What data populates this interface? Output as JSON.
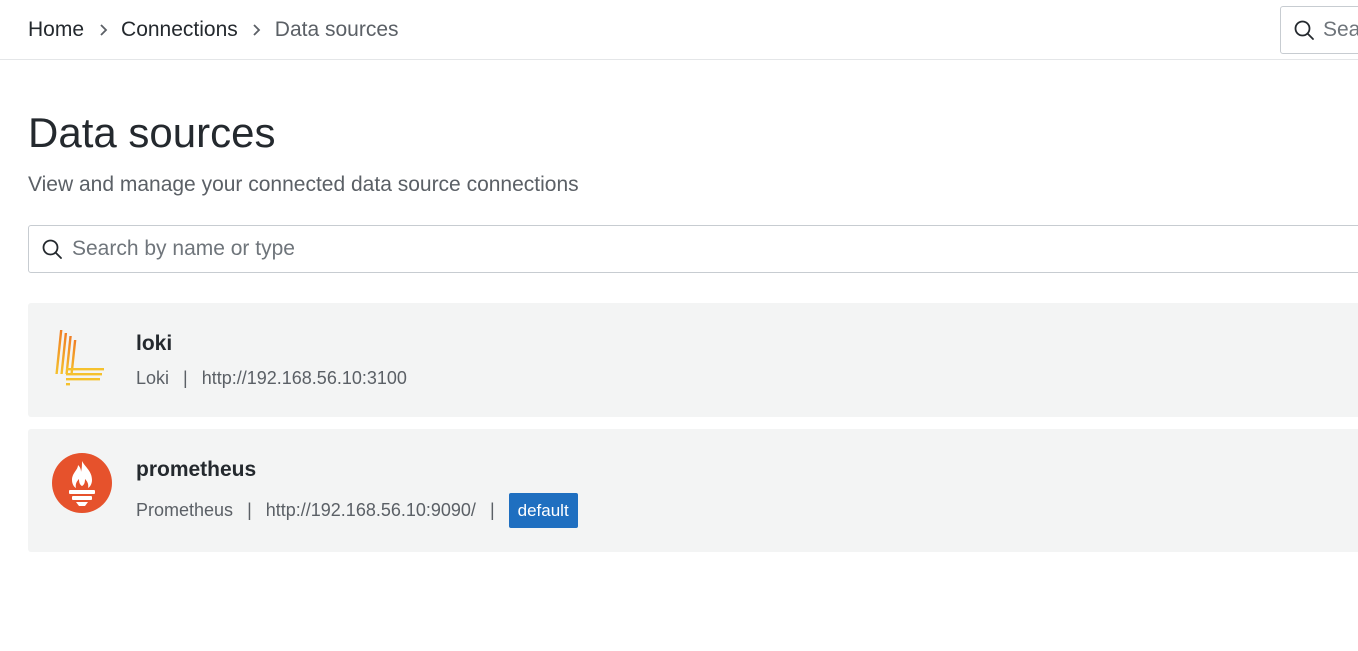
{
  "breadcrumb": {
    "items": [
      "Home",
      "Connections",
      "Data sources"
    ]
  },
  "top_search": {
    "placeholder": "Search"
  },
  "page": {
    "title": "Data sources",
    "subtitle": "View and manage your connected data source connections"
  },
  "search": {
    "placeholder": "Search by name or type",
    "value": ""
  },
  "datasources": [
    {
      "name": "loki",
      "type": "Loki",
      "url": "http://192.168.56.10:3100",
      "logo": "loki-logo-icon"
    },
    {
      "name": "prometheus",
      "type": "Prometheus",
      "url": "http://192.168.56.10:9090/",
      "badge": "default",
      "logo": "prometheus-logo-icon"
    }
  ],
  "colors": {
    "badge_bg": "#1f6fc0",
    "card_bg": "#f3f4f4",
    "prometheus_orange": "#e6522c",
    "loki_yellow": "#f5c12d",
    "loki_orange": "#f07d24"
  }
}
